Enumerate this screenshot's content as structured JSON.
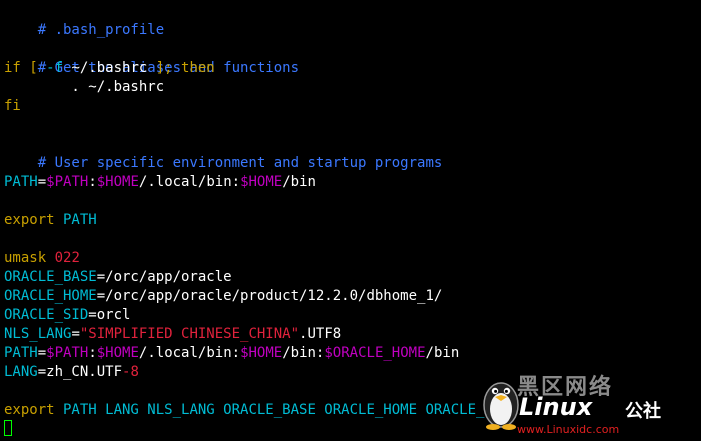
{
  "file": {
    "title_comment": "# .bash_profile"
  },
  "lines": {
    "l2": "# Get the aliases and functions",
    "l3_if": "if",
    "l3_bracket_open": " [ ",
    "l3_test": "-f",
    "l3_path": " ~/.bashrc ",
    "l3_bracket_close": "];",
    "l3_then": " then",
    "l4": "        . ~/.bashrc",
    "l5_fi": "fi",
    "l7": "# User specific environment and startup programs",
    "l9_name": "PATH",
    "l9_eq": "=",
    "l9_var1": "$PATH",
    "l9_colon1": ":",
    "l9_var2": "$HOME",
    "l9_mid": "/.local/bin:",
    "l9_var3": "$HOME",
    "l9_end": "/bin",
    "l11_export": "export",
    "l11_name": " PATH",
    "l13_umask": "umask",
    "l13_value": " 022",
    "l14_name": "ORACLE_BASE",
    "l14_value": "=/orc/app/oracle",
    "l15_name": "ORACLE_HOME",
    "l15_value": "=/orc/app/oracle/product/12.2.0/dbhome_1/",
    "l16_name": "ORACLE_SID",
    "l16_value": "=orcl",
    "l17_name": "NLS_LANG",
    "l17_eq": "=",
    "l17_str": "\"SIMPLIFIED CHINESE_CHINA\"",
    "l17_end": ".UTF8",
    "l18_name": "PATH",
    "l18_eq": "=",
    "l18_var1": "$PATH",
    "l18_colon1": ":",
    "l18_var2": "$HOME",
    "l18_mid": "/.local/bin:",
    "l18_var3": "$HOME",
    "l18_mid2": "/bin:",
    "l18_var4": "$ORACLE_HOME",
    "l18_end": "/bin",
    "l19_name": "LANG",
    "l19_value": "=zh_CN.UTF",
    "l19_num": "-8",
    "l21_export": "export",
    "l21_names": " PATH LANG NLS_LANG ORACLE_BASE ORACLE_HOME ORACLE_SI"
  },
  "watermark": {
    "cn_title": "黑区网络",
    "brand": "Linux",
    "brand_cn": "公社",
    "url": "www.Linuxidc.com"
  },
  "colors": {
    "background": "#000000",
    "comment": "#3b78ff",
    "keyword": "#c8a000",
    "identifier": "#00bcd4",
    "variable": "#c000c0",
    "string": "#e0223c",
    "cursor": "#00ff00"
  }
}
